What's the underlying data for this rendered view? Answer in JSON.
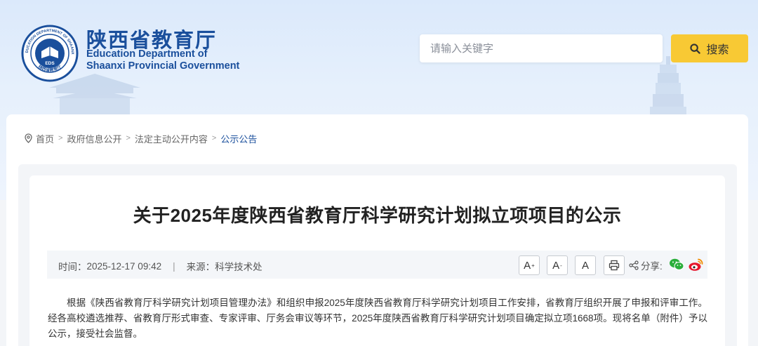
{
  "header": {
    "title_cn": "陕西省教育厅",
    "title_en_line1": "Education Department of",
    "title_en_line2": "Shaanxi Provincial Government",
    "logo_text_top": "EDUCATION DEPARTMENT OF SHAANXI",
    "logo_center": "EDS",
    "logo_text_bottom": "陕西省教育厅"
  },
  "search": {
    "placeholder": "请输入关键字",
    "button_label": "搜索"
  },
  "breadcrumb": {
    "items": [
      "首页",
      "政府信息公开",
      "法定主动公开内容",
      "公示公告"
    ],
    "separator": ">"
  },
  "article": {
    "title": "关于2025年度陕西省教育厅科学研究计划拟立项项目的公示",
    "time_label": "时间：",
    "time_value": "2025-12-17 09:42",
    "divider": "|",
    "source_label": "来源：",
    "source_value": "科学技术处",
    "font_large": "A",
    "font_small": "A",
    "font_default": "A",
    "share_label": "分享:",
    "paragraph": "根据《陕西省教育厅科学研究计划项目管理办法》和组织申报2025年度陕西省教育厅科学研究计划项目工作安排，省教育厅组织开展了申报和评审工作。经各高校遴选推荐、省教育厅形式审查、专家评审、厅务会审议等环节，2025年度陕西省教育厅科学研究计划项目确定拟立项1668项。现将名单（附件）予以公示，接受社会监督。"
  },
  "icons": {
    "search": "search-icon",
    "location": "location-pin-icon",
    "print": "printer-icon",
    "share": "share-icon",
    "wechat": "wechat-icon",
    "weibo": "weibo-icon"
  },
  "colors": {
    "brand_blue": "#1a4f9c",
    "search_button": "#f8c934",
    "wechat_green": "#2aae3a",
    "weibo_red": "#e6162d"
  }
}
